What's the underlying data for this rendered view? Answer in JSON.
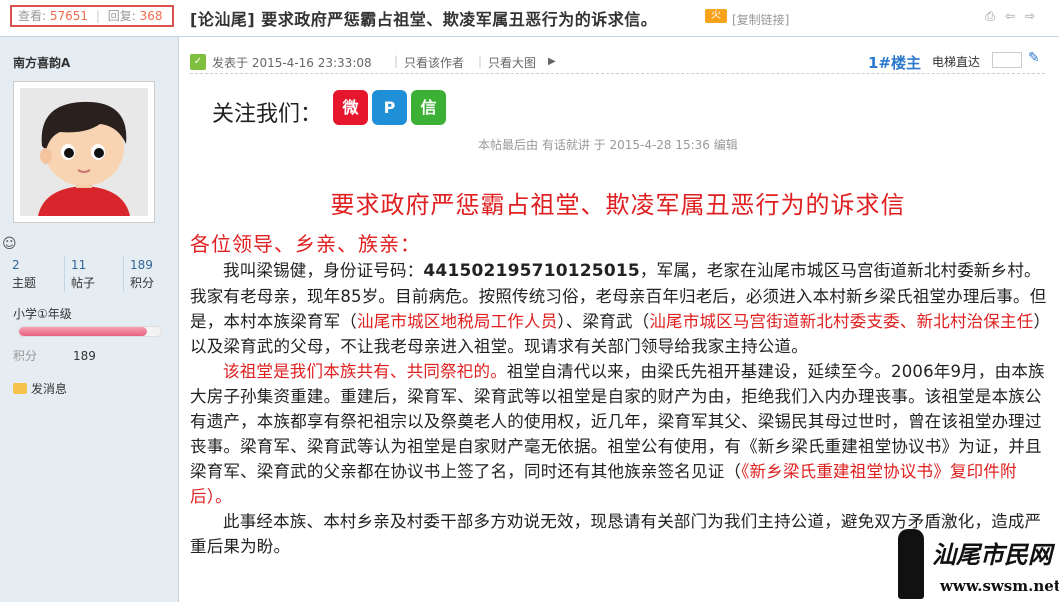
{
  "stats": {
    "views_label": "查看:",
    "views": "57651",
    "sep": "|",
    "replies_label": "回复:",
    "replies": "368"
  },
  "thread": {
    "title": "[论汕尾] 要求政府严惩霸占祖堂、欺凌军属丑恶行为的诉求信。",
    "hot_badge": "火",
    "copy_link": "[复制链接]"
  },
  "top_icons": [
    "print-icon",
    "prev-icon",
    "next-icon"
  ],
  "user": {
    "name": "南方喜韵A",
    "topics": {
      "value": "2",
      "label": "主题"
    },
    "posts": {
      "value": "11",
      "label": "帖子"
    },
    "credits": {
      "value": "189",
      "label": "积分"
    },
    "level": "小学①年级",
    "level_progress": 0.9,
    "points_label": "积分",
    "points_value": "189",
    "send_message": "发消息"
  },
  "post": {
    "posted_on": "发表于 2015-4-16 23:33:08",
    "only_author": "只看该作者",
    "big_image": "只看大图",
    "floor": "1#楼主",
    "lift_label": "电梯直达",
    "follow_us": "关注我们：",
    "social": [
      "weibo-icon",
      "tencent-weibo-icon",
      "wechat-icon"
    ],
    "edited": "本帖最后由 有话就讲 于 2015-4-28 15:36 编辑",
    "letter_title": "要求政府严惩霸占祖堂、欺凌军属丑恶行为的诉求信",
    "greeting": "各位领导、乡亲、族亲：",
    "p1a": "我叫梁锡健，身份证号码：",
    "p1_id": "441502195710125015",
    "p1b": "，军属，老家在汕尾市城区马宫街道新北村委新乡村。我家有老母亲，现年",
    "p1_age": "85",
    "p1c": "岁。目前病危。按照传统习俗，老母亲百年归老后，必须进入本村新乡梁氏祖堂办理后事。但是，本村本族梁育军（",
    "p1_red1": "汕尾市城区地税局工作人员",
    "p1d": "）、梁育武（",
    "p1_red2": "汕尾市城区马宫街道新北村委支委、新北村治保主任",
    "p1e": "）以及梁育武的父母，不让我老母亲进入祖堂。现请求有关部门领导给我家主持公道。",
    "p2_red": "该祖堂是我们本族共有、共同祭祀的。",
    "p2a": "祖堂自清代以来，由梁氏先祖开基建设，延续至今。",
    "p2_year": "2006年9",
    "p2b": "月，由本族大房子孙集资重建。重建后，梁育军、梁育武等以祖堂是自家的财产为由，拒绝我们入内办理丧事。该祖堂是本族公有遗产，本族都享有祭祀祖宗以及祭奠老人的使用权，近几年，梁育军其父、梁锡民其母过世时，曾在该祖堂办理过丧事。梁育军、梁育武等认为祖堂是自家财产毫无依据。祖堂公有使用，有《新乡梁氏重建祖堂协议书》为证，并且梁育军、梁育武的父亲都在协议书上签了名，同时还有其他族亲签名见证（",
    "p2_red2": "《新乡梁氏重建祖堂协议书》复印件附后",
    "p2c": "）。",
    "p3": "此事经本族、本村乡亲及村委干部多方劝说无效，现恳请有关部门为我们主持公道，避免双方矛盾激化，造成严重后果为盼。"
  },
  "watermark": {
    "name": "汕尾市民网",
    "url": "www.swsm.net"
  },
  "colors": {
    "accent_red": "#e02020",
    "link_blue": "#2b7acd",
    "sidebar_bg": "#e5edf2"
  }
}
